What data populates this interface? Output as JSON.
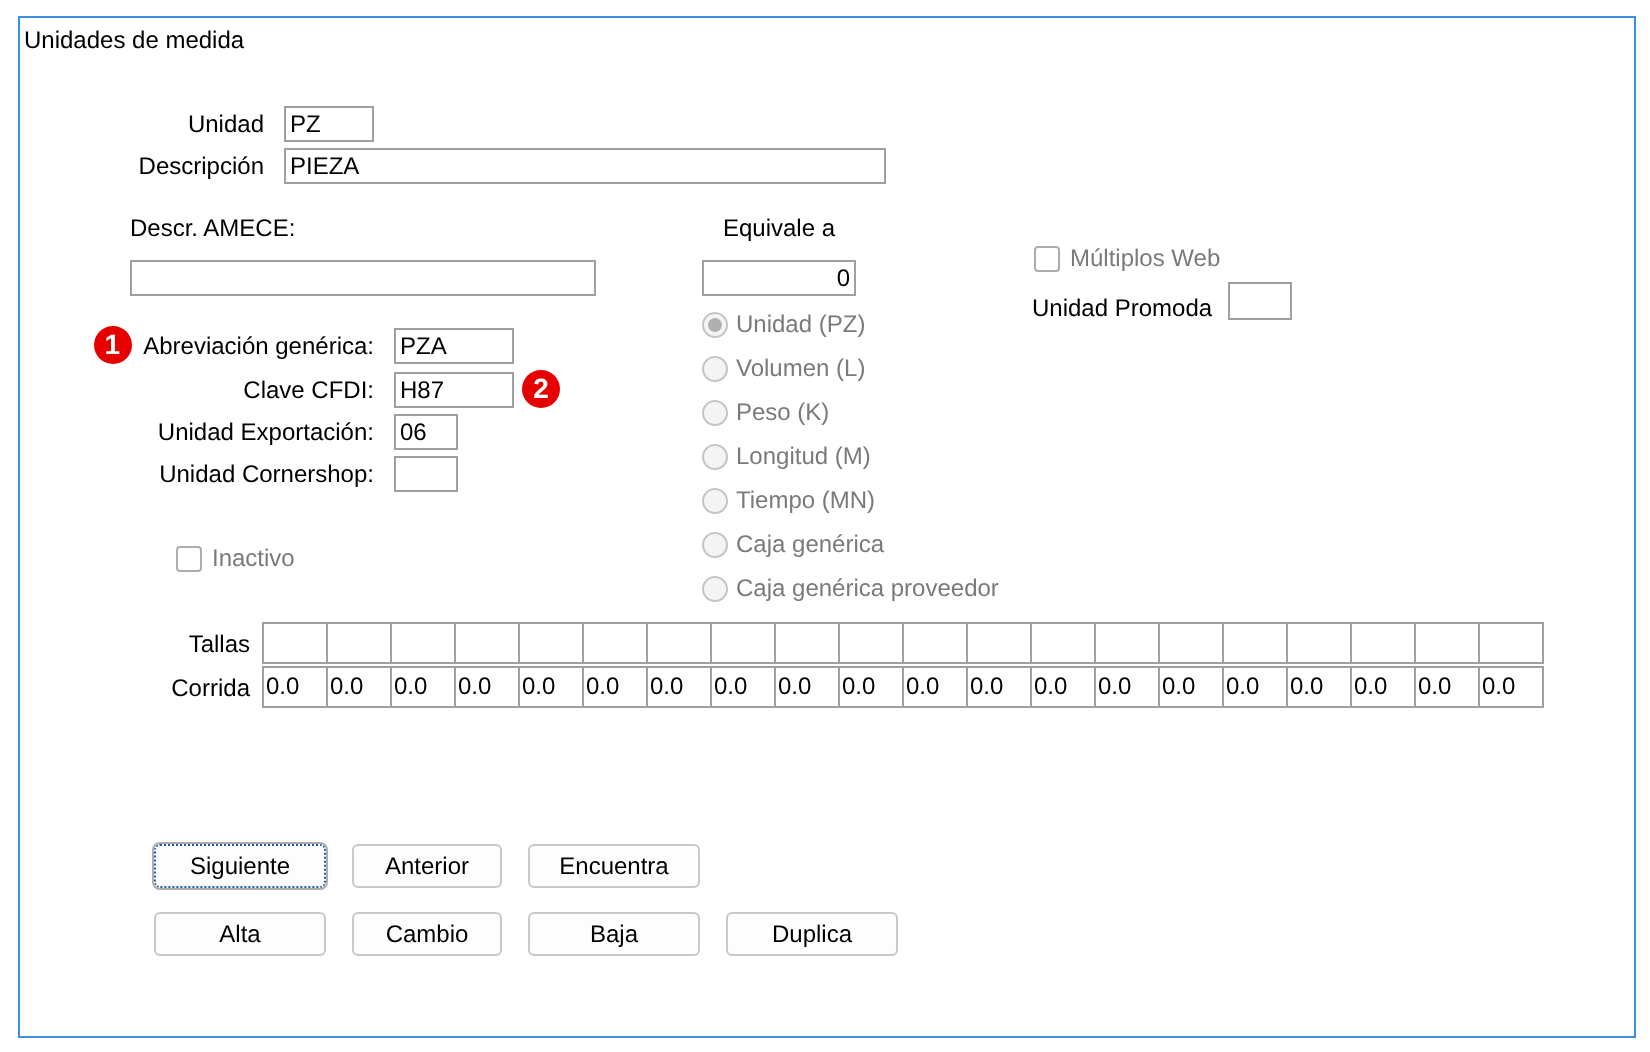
{
  "window": {
    "title": "Unidades de medida"
  },
  "header_fields": [
    {
      "label": "Unidad",
      "value": "PZ"
    },
    {
      "label": "Descripción",
      "value": "PIEZA"
    }
  ],
  "amece": {
    "label": "Descr. AMECE:"
  },
  "codes": [
    {
      "kind": "leading",
      "label": "Abreviación genérica:",
      "value": "PZA",
      "callout": "1"
    },
    {
      "kind": "trailing",
      "label": "Clave CFDI:",
      "value": "H87",
      "callout": "2"
    },
    {
      "kind": "plain",
      "label": "Unidad Exportación:",
      "value": "06"
    },
    {
      "kind": "plain",
      "label": "Unidad Cornershop:"
    }
  ],
  "inactivo": {
    "label": "Inactivo",
    "checked": false,
    "disabled": true
  },
  "equivale": {
    "label": "Equivale a",
    "value": "0"
  },
  "unit_types": [
    {
      "label": "Unidad (PZ)",
      "selected": true,
      "disabled": true
    },
    {
      "label": "Volumen (L)",
      "selected": false,
      "disabled": true
    },
    {
      "label": "Peso (K)",
      "selected": false,
      "disabled": true
    },
    {
      "label": "Longitud (M)",
      "selected": false,
      "disabled": true
    },
    {
      "label": "Tiempo (MN)",
      "selected": false,
      "disabled": true
    },
    {
      "label": "Caja genérica",
      "selected": false,
      "disabled": true
    },
    {
      "label": "Caja genérica proveedor",
      "selected": false,
      "disabled": true
    }
  ],
  "multiplos_web": {
    "label": "Múltiplos Web",
    "checked": false,
    "disabled": true
  },
  "unidad_promoda": {
    "label": "Unidad Promoda"
  },
  "tallas": {
    "label": "Tallas"
  },
  "corrida": {
    "label": "Corrida",
    "values": [
      "0.0",
      "0.0",
      "0.0",
      "0.0",
      "0.0",
      "0.0",
      "0.0",
      "0.0",
      "0.0",
      "0.0",
      "0.0",
      "0.0",
      "0.0",
      "0.0",
      "0.0",
      "0.0",
      "0.0",
      "0.0",
      "0.0",
      "0.0"
    ]
  },
  "button_rows": [
    {
      "buttons": [
        {
          "label": "Siguiente",
          "focused": true
        },
        {
          "label": "Anterior",
          "focused": false
        },
        {
          "label": "Encuentra",
          "focused": false
        }
      ]
    },
    {
      "buttons": [
        {
          "label": "Alta",
          "focused": false
        },
        {
          "label": "Cambio",
          "focused": false
        },
        {
          "label": "Baja",
          "focused": false
        },
        {
          "label": "Duplica",
          "focused": false
        }
      ]
    }
  ]
}
